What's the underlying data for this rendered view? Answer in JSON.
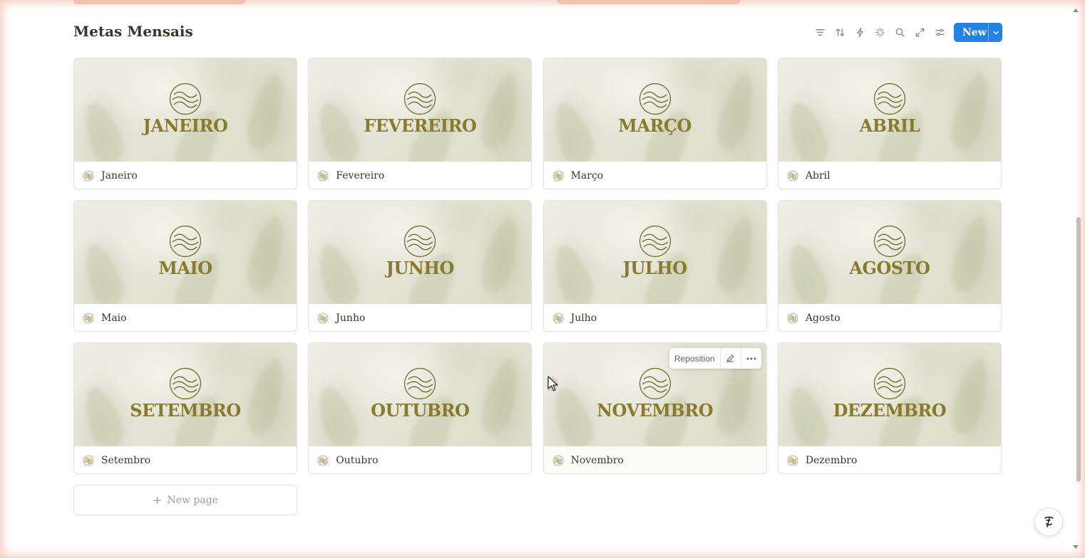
{
  "database": {
    "title": "Metas Mensais",
    "new_button_label": "New"
  },
  "toolbar": {
    "icons": [
      "filter-icon",
      "sort-icon",
      "automation-icon",
      "ai-sparkle-icon",
      "search-icon",
      "expand-icon",
      "settings-icon"
    ]
  },
  "cards": [
    {
      "cover_text": "JANEIRO",
      "title": "Janeiro"
    },
    {
      "cover_text": "FEVEREIRO",
      "title": "Fevereiro"
    },
    {
      "cover_text": "MARÇO",
      "title": "Março"
    },
    {
      "cover_text": "ABRIL",
      "title": "Abril"
    },
    {
      "cover_text": "MAIO",
      "title": "Maio"
    },
    {
      "cover_text": "JUNHO",
      "title": "Junho"
    },
    {
      "cover_text": "JULHO",
      "title": "Julho"
    },
    {
      "cover_text": "AGOSTO",
      "title": "Agosto"
    },
    {
      "cover_text": "SETEMBRO",
      "title": "Setembro"
    },
    {
      "cover_text": "OUTUBRO",
      "title": "Outubro"
    },
    {
      "cover_text": "NOVEMBRO",
      "title": "Novembro"
    },
    {
      "cover_text": "DEZEMBRO",
      "title": "Dezembro"
    }
  ],
  "cover_hover_menu": {
    "reposition_label": "Reposition"
  },
  "new_page": {
    "label": "New page"
  },
  "colors": {
    "accent": "#2383e2",
    "cover_text": "#8a7a2e"
  }
}
